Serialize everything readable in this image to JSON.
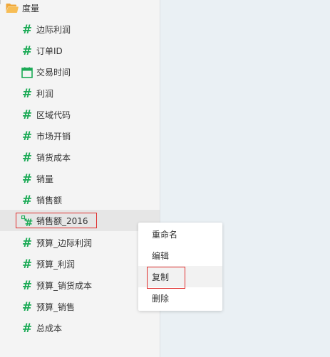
{
  "folder": {
    "label": "度量",
    "icon": "folder-open-icon",
    "icon_color": "#f0a83a"
  },
  "fields": [
    {
      "label": "边际利润",
      "icon": "hash-icon"
    },
    {
      "label": "订单ID",
      "icon": "hash-icon"
    },
    {
      "label": "交易时间",
      "icon": "calendar-icon"
    },
    {
      "label": "利润",
      "icon": "hash-icon"
    },
    {
      "label": "区域代码",
      "icon": "hash-icon"
    },
    {
      "label": "市场开销",
      "icon": "hash-icon"
    },
    {
      "label": "销货成本",
      "icon": "hash-icon"
    },
    {
      "label": "销量",
      "icon": "hash-icon"
    },
    {
      "label": "销售额",
      "icon": "hash-icon"
    },
    {
      "label": "销售额_2016",
      "icon": "calculated-hash-icon",
      "selected": true
    },
    {
      "label": "预算_边际利润",
      "icon": "hash-icon"
    },
    {
      "label": "预算_利润",
      "icon": "hash-icon"
    },
    {
      "label": "预算_销货成本",
      "icon": "hash-icon"
    },
    {
      "label": "预算_销售",
      "icon": "hash-icon"
    },
    {
      "label": "总成本",
      "icon": "hash-icon"
    }
  ],
  "context_menu": {
    "items": [
      {
        "label": "重命名"
      },
      {
        "label": "编辑"
      },
      {
        "label": "复制",
        "hovered": true
      },
      {
        "label": "删除"
      }
    ]
  },
  "colors": {
    "measure_icon": "#1aaa55",
    "highlight_border": "#e0302f",
    "panel_bg": "#f4f4f4",
    "canvas_bg": "#eaf0f4"
  }
}
